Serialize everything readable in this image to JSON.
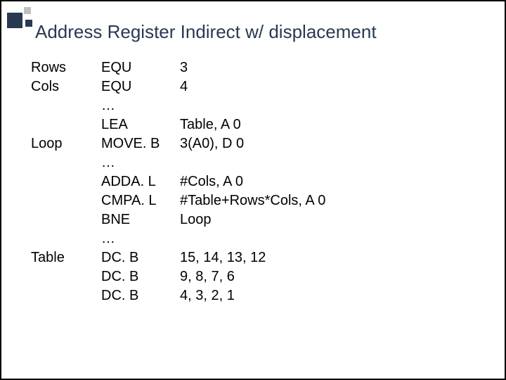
{
  "title": "Address Register Indirect w/ displacement",
  "lines": [
    {
      "label": "Rows",
      "mnemonic": "EQU",
      "operand": "3"
    },
    {
      "label": "Cols",
      "mnemonic": "EQU",
      "operand": "4"
    },
    {
      "label": "",
      "mnemonic": "…",
      "operand": ""
    },
    {
      "label": "",
      "mnemonic": "LEA",
      "operand": "Table, A 0"
    },
    {
      "label": "Loop",
      "mnemonic": "MOVE. B",
      "operand": "3(A0), D 0"
    },
    {
      "label": "",
      "mnemonic": "…",
      "operand": ""
    },
    {
      "label": "",
      "mnemonic": "ADDA. L",
      "operand": "#Cols, A 0"
    },
    {
      "label": "",
      "mnemonic": "CMPA. L",
      "operand": "#Table+Rows*Cols, A 0"
    },
    {
      "label": "",
      "mnemonic": "BNE",
      "operand": "Loop"
    },
    {
      "label": "",
      "mnemonic": "…",
      "operand": ""
    },
    {
      "label": "Table",
      "mnemonic": "DC. B",
      "operand": "15, 14, 13, 12"
    },
    {
      "label": "",
      "mnemonic": "DC. B",
      "operand": "9, 8, 7, 6"
    },
    {
      "label": "",
      "mnemonic": "DC. B",
      "operand": "4, 3, 2, 1"
    }
  ]
}
